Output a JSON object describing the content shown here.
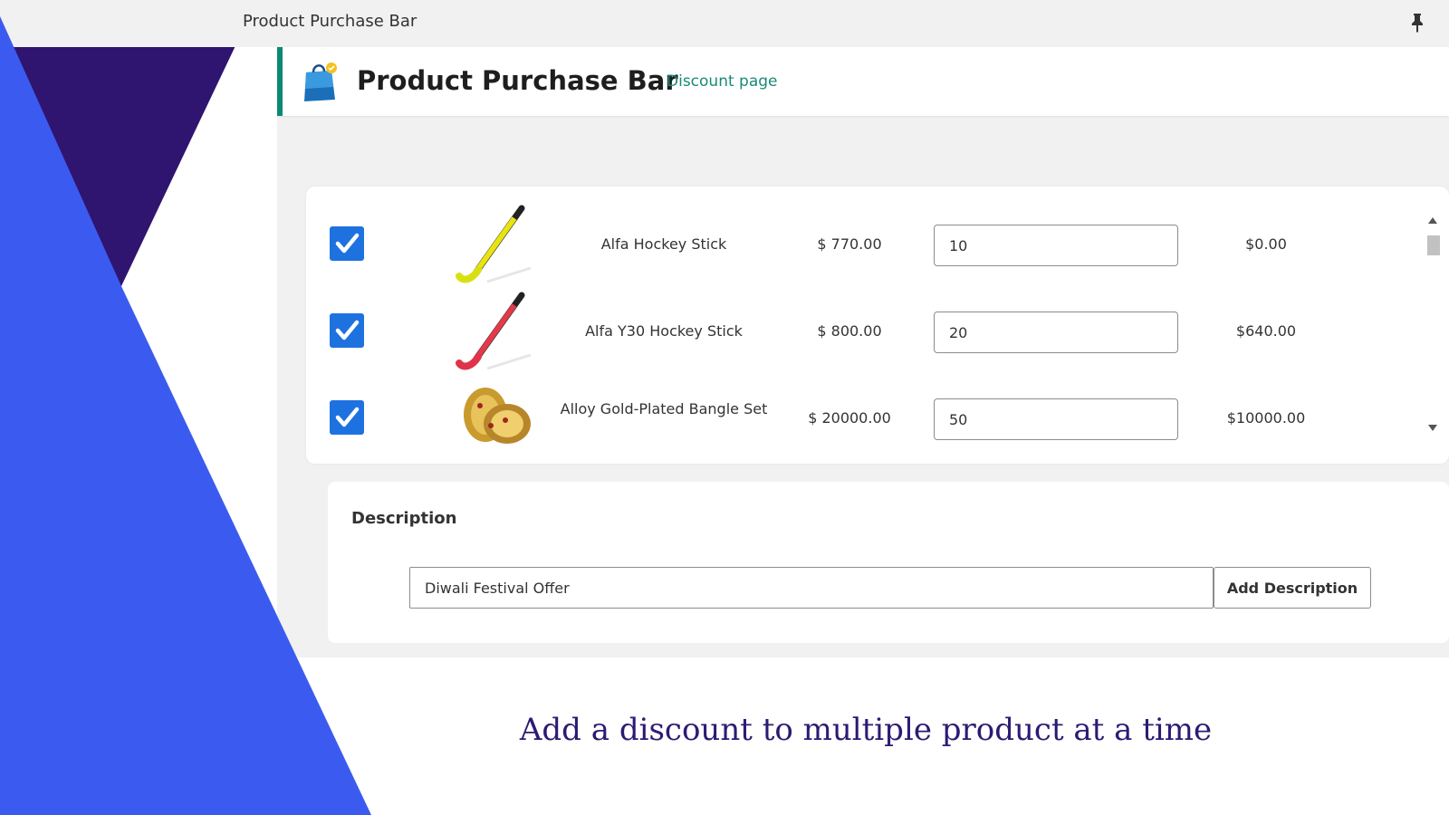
{
  "window": {
    "title": "Product Purchase Bar",
    "pin_icon": "pin-icon"
  },
  "header": {
    "title": "Product Purchase Bar",
    "icon": "shopping-bag-icon",
    "link": "Discount page",
    "accent_color": "#0a8a74"
  },
  "products": [
    {
      "checked": true,
      "name": "Alfa Hockey Stick",
      "price": "$ 770.00",
      "quantity": "10",
      "discount": "$0.00",
      "thumbnail": "yellow-hockey-stick"
    },
    {
      "checked": true,
      "name": "Alfa Y30 Hockey Stick",
      "price": "$ 800.00",
      "quantity": "20",
      "discount": "$640.00",
      "thumbnail": "red-hockey-stick"
    },
    {
      "checked": true,
      "name": "Alloy Gold-Plated Bangle Set",
      "price": "$ 20000.00",
      "quantity": "50",
      "discount": "$10000.00",
      "thumbnail": "gold-bangle-set"
    }
  ],
  "description": {
    "label": "Description",
    "value": "Diwali Festival Offer",
    "button": "Add Description"
  },
  "caption": "Add a discount to multiple product at a time",
  "colors": {
    "checkbox": "#1e72e0",
    "shape_dark": "#2f1470",
    "shape_blue": "#3b5bf0",
    "caption": "#2d1a74"
  }
}
